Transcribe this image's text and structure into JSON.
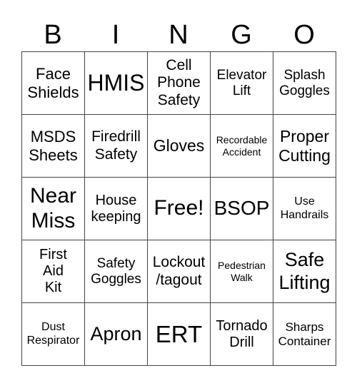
{
  "header": {
    "letters": [
      "B",
      "I",
      "N",
      "G",
      "O"
    ]
  },
  "rows": [
    [
      "Face\nShields",
      "HMIS",
      "Cell\nPhone\nSafety",
      "Elevator\nLift",
      "Splash\nGoggles"
    ],
    [
      "MSDS\nSheets",
      "Firedrill\nSafety",
      "Gloves",
      "Recordable\nAccident",
      "Proper\nCutting"
    ],
    [
      "Near\nMiss",
      "House\nkeeping",
      "Free!",
      "BSOP",
      "Use\nHandrails"
    ],
    [
      "First\nAid\nKit",
      "Safety\nGoggles",
      "Lockout\n/tagout",
      "Pedestrian\nWalk",
      "Safe\nLifting"
    ],
    [
      "Dust\nRespirator",
      "Apron",
      "ERT",
      "Tornado\nDrill",
      "Sharps\nContainer"
    ]
  ]
}
